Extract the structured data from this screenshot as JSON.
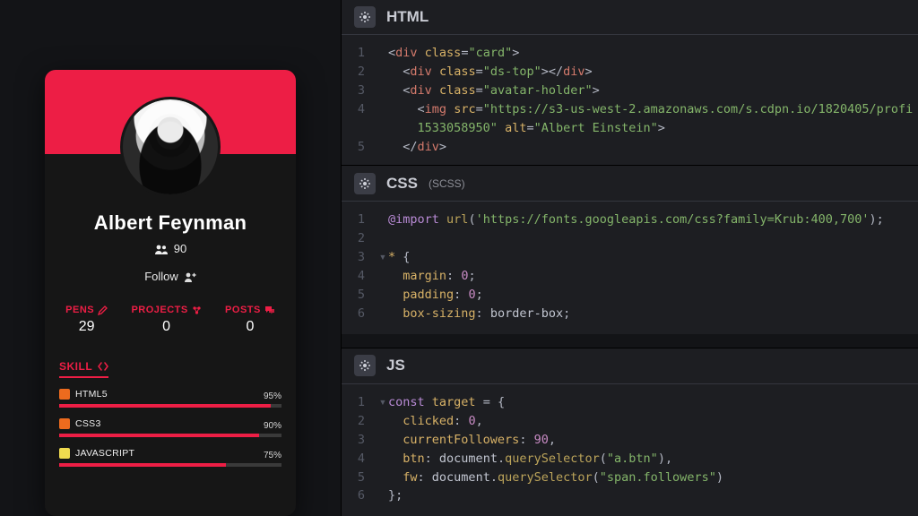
{
  "preview": {
    "card": {
      "name": "Albert Feynman",
      "followers": "90",
      "follow_label": "Follow",
      "stats": [
        {
          "label": "PENS",
          "value": "29"
        },
        {
          "label": "PROJECTS",
          "value": "0"
        },
        {
          "label": "POSTS",
          "value": "0"
        }
      ],
      "skill_title": "SKILL",
      "skills": [
        {
          "name": "HTML5",
          "pct": "95%",
          "w": "95%"
        },
        {
          "name": "CSS3",
          "pct": "90%",
          "w": "90%"
        },
        {
          "name": "JAVASCRIPT",
          "pct": "75%",
          "w": "75%"
        }
      ]
    }
  },
  "editors": {
    "html": {
      "title": "HTML",
      "lines": [
        {
          "n": "1",
          "frags": [
            {
              "t": "<",
              "c": "t-punc"
            },
            {
              "t": "div",
              "c": "t-tag"
            },
            {
              "t": " ",
              "c": "t-plain"
            },
            {
              "t": "class",
              "c": "t-attr"
            },
            {
              "t": "=",
              "c": "t-punc"
            },
            {
              "t": "\"card\"",
              "c": "t-str"
            },
            {
              "t": ">",
              "c": "t-punc"
            }
          ]
        },
        {
          "n": "2",
          "frags": [
            {
              "t": "  ",
              "c": "t-plain"
            },
            {
              "t": "<",
              "c": "t-punc"
            },
            {
              "t": "div",
              "c": "t-tag"
            },
            {
              "t": " ",
              "c": "t-plain"
            },
            {
              "t": "class",
              "c": "t-attr"
            },
            {
              "t": "=",
              "c": "t-punc"
            },
            {
              "t": "\"ds-top\"",
              "c": "t-str"
            },
            {
              "t": "></",
              "c": "t-punc"
            },
            {
              "t": "div",
              "c": "t-tag"
            },
            {
              "t": ">",
              "c": "t-punc"
            }
          ]
        },
        {
          "n": "3",
          "frags": [
            {
              "t": "  ",
              "c": "t-plain"
            },
            {
              "t": "<",
              "c": "t-punc"
            },
            {
              "t": "div",
              "c": "t-tag"
            },
            {
              "t": " ",
              "c": "t-plain"
            },
            {
              "t": "class",
              "c": "t-attr"
            },
            {
              "t": "=",
              "c": "t-punc"
            },
            {
              "t": "\"avatar-holder\"",
              "c": "t-str"
            },
            {
              "t": ">",
              "c": "t-punc"
            }
          ]
        },
        {
          "n": "4",
          "frags": [
            {
              "t": "    ",
              "c": "t-plain"
            },
            {
              "t": "<",
              "c": "t-punc"
            },
            {
              "t": "img",
              "c": "t-tag"
            },
            {
              "t": " ",
              "c": "t-plain"
            },
            {
              "t": "src",
              "c": "t-attr"
            },
            {
              "t": "=",
              "c": "t-punc"
            },
            {
              "t": "\"https://s3-us-west-2.amazonaws.com/s.cdpn.io/1820405/profi",
              "c": "t-str"
            }
          ]
        },
        {
          "n": "",
          "frags": [
            {
              "t": "    1533058950\"",
              "c": "t-str"
            },
            {
              "t": " ",
              "c": "t-plain"
            },
            {
              "t": "alt",
              "c": "t-attr"
            },
            {
              "t": "=",
              "c": "t-punc"
            },
            {
              "t": "\"Albert Einstein\"",
              "c": "t-str"
            },
            {
              "t": ">",
              "c": "t-punc"
            }
          ]
        },
        {
          "n": "5",
          "frags": [
            {
              "t": "  ",
              "c": "t-plain"
            },
            {
              "t": "</",
              "c": "t-punc"
            },
            {
              "t": "div",
              "c": "t-tag"
            },
            {
              "t": ">",
              "c": "t-punc"
            }
          ]
        }
      ]
    },
    "css": {
      "title": "CSS",
      "subtitle": "(SCSS)",
      "lines": [
        {
          "n": "1",
          "frags": [
            {
              "t": "@import",
              "c": "t-kw"
            },
            {
              "t": " ",
              "c": "t-plain"
            },
            {
              "t": "url",
              "c": "t-func"
            },
            {
              "t": "(",
              "c": "t-punc"
            },
            {
              "t": "'https://fonts.googleapis.com/css?family=Krub:400,700'",
              "c": "t-str"
            },
            {
              "t": ");",
              "c": "t-punc"
            }
          ]
        },
        {
          "n": "2",
          "frags": [
            {
              "t": " ",
              "c": "t-plain"
            }
          ]
        },
        {
          "n": "3",
          "frags": [
            {
              "t": "* ",
              "c": "t-sel"
            },
            {
              "t": "{",
              "c": "t-punc"
            }
          ]
        },
        {
          "n": "4",
          "frags": [
            {
              "t": "  ",
              "c": "t-plain"
            },
            {
              "t": "margin",
              "c": "t-attr"
            },
            {
              "t": ": ",
              "c": "t-punc"
            },
            {
              "t": "0",
              "c": "t-num"
            },
            {
              "t": ";",
              "c": "t-punc"
            }
          ]
        },
        {
          "n": "5",
          "frags": [
            {
              "t": "  ",
              "c": "t-plain"
            },
            {
              "t": "padding",
              "c": "t-attr"
            },
            {
              "t": ": ",
              "c": "t-punc"
            },
            {
              "t": "0",
              "c": "t-num"
            },
            {
              "t": ";",
              "c": "t-punc"
            }
          ]
        },
        {
          "n": "6",
          "frags": [
            {
              "t": "  ",
              "c": "t-plain"
            },
            {
              "t": "box-sizing",
              "c": "t-attr"
            },
            {
              "t": ": ",
              "c": "t-punc"
            },
            {
              "t": "border-box",
              "c": "t-plain"
            },
            {
              "t": ";",
              "c": "t-punc"
            }
          ]
        }
      ]
    },
    "js": {
      "title": "JS",
      "lines": [
        {
          "n": "1",
          "frags": [
            {
              "t": "const",
              "c": "t-kw"
            },
            {
              "t": " ",
              "c": "t-plain"
            },
            {
              "t": "target",
              "c": "t-sel"
            },
            {
              "t": " = {",
              "c": "t-punc"
            }
          ]
        },
        {
          "n": "2",
          "frags": [
            {
              "t": "  ",
              "c": "t-plain"
            },
            {
              "t": "clicked",
              "c": "t-attr"
            },
            {
              "t": ": ",
              "c": "t-punc"
            },
            {
              "t": "0",
              "c": "t-num"
            },
            {
              "t": ",",
              "c": "t-punc"
            }
          ]
        },
        {
          "n": "3",
          "frags": [
            {
              "t": "  ",
              "c": "t-plain"
            },
            {
              "t": "currentFollowers",
              "c": "t-attr"
            },
            {
              "t": ": ",
              "c": "t-punc"
            },
            {
              "t": "90",
              "c": "t-num"
            },
            {
              "t": ",",
              "c": "t-punc"
            }
          ]
        },
        {
          "n": "4",
          "frags": [
            {
              "t": "  ",
              "c": "t-plain"
            },
            {
              "t": "btn",
              "c": "t-attr"
            },
            {
              "t": ": ",
              "c": "t-punc"
            },
            {
              "t": "document",
              "c": "t-plain"
            },
            {
              "t": ".",
              "c": "t-punc"
            },
            {
              "t": "querySelector",
              "c": "t-func"
            },
            {
              "t": "(",
              "c": "t-punc"
            },
            {
              "t": "\"a.btn\"",
              "c": "t-str"
            },
            {
              "t": "),",
              "c": "t-punc"
            }
          ]
        },
        {
          "n": "5",
          "frags": [
            {
              "t": "  ",
              "c": "t-plain"
            },
            {
              "t": "fw",
              "c": "t-attr"
            },
            {
              "t": ": ",
              "c": "t-punc"
            },
            {
              "t": "document",
              "c": "t-plain"
            },
            {
              "t": ".",
              "c": "t-punc"
            },
            {
              "t": "querySelector",
              "c": "t-func"
            },
            {
              "t": "(",
              "c": "t-punc"
            },
            {
              "t": "\"span.followers\"",
              "c": "t-str"
            },
            {
              "t": ")",
              "c": "t-punc"
            }
          ]
        },
        {
          "n": "6",
          "frags": [
            {
              "t": "};",
              "c": "t-punc"
            }
          ]
        }
      ]
    }
  },
  "heights": {
    "html": 184,
    "css": 204,
    "js": 188
  }
}
